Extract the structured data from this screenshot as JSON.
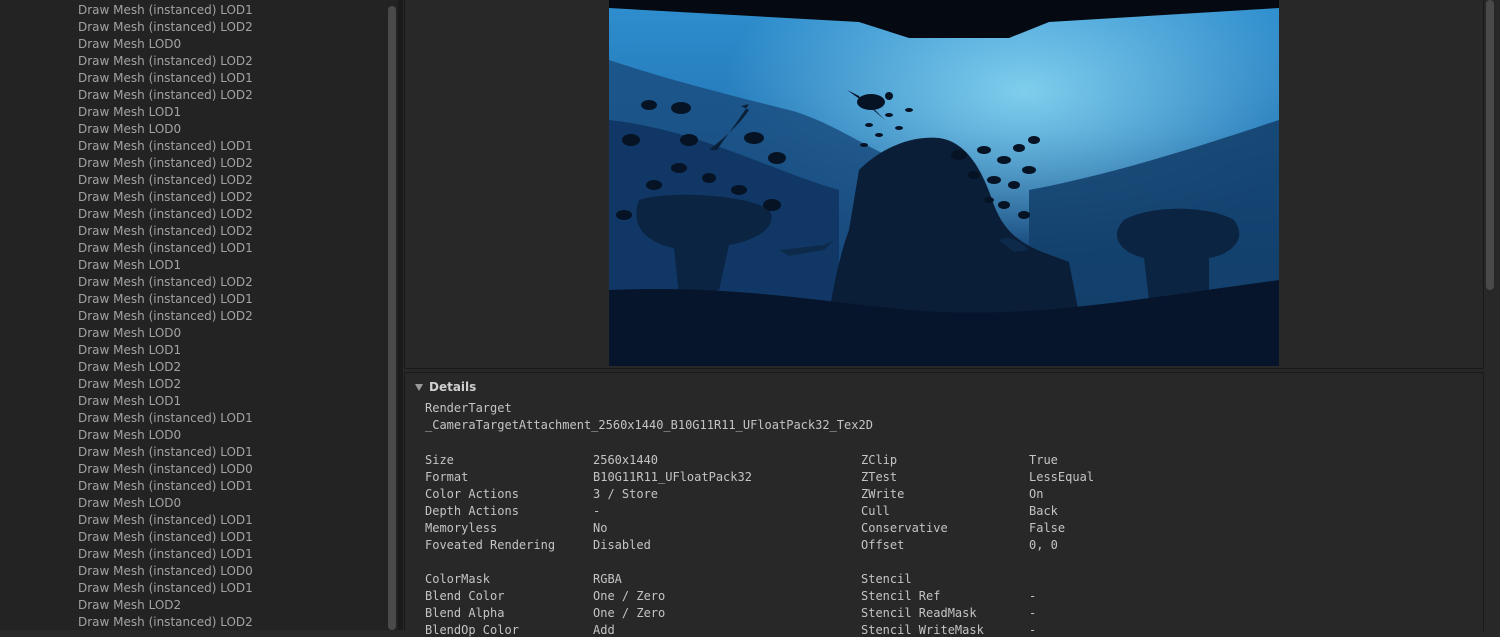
{
  "event_list": [
    "Draw Mesh (instanced) LOD1",
    "Draw Mesh (instanced) LOD2",
    "Draw Mesh LOD0",
    "Draw Mesh (instanced) LOD2",
    "Draw Mesh (instanced) LOD1",
    "Draw Mesh (instanced) LOD2",
    "Draw Mesh LOD1",
    "Draw Mesh LOD0",
    "Draw Mesh (instanced) LOD1",
    "Draw Mesh (instanced) LOD2",
    "Draw Mesh (instanced) LOD2",
    "Draw Mesh (instanced) LOD2",
    "Draw Mesh (instanced) LOD2",
    "Draw Mesh (instanced) LOD2",
    "Draw Mesh (instanced) LOD1",
    "Draw Mesh LOD1",
    "Draw Mesh (instanced) LOD2",
    "Draw Mesh (instanced) LOD1",
    "Draw Mesh (instanced) LOD2",
    "Draw Mesh LOD0",
    "Draw Mesh LOD1",
    "Draw Mesh LOD2",
    "Draw Mesh LOD2",
    "Draw Mesh LOD1",
    "Draw Mesh (instanced) LOD1",
    "Draw Mesh LOD0",
    "Draw Mesh (instanced) LOD1",
    "Draw Mesh (instanced) LOD0",
    "Draw Mesh (instanced) LOD1",
    "Draw Mesh LOD0",
    "Draw Mesh (instanced) LOD1",
    "Draw Mesh (instanced) LOD1",
    "Draw Mesh (instanced) LOD1",
    "Draw Mesh (instanced) LOD0",
    "Draw Mesh (instanced) LOD1",
    "Draw Mesh LOD2",
    "Draw Mesh (instanced) LOD2"
  ],
  "details": {
    "header": "Details",
    "render_target_label": "RenderTarget",
    "render_target_name": "_CameraTargetAttachment_2560x1440_B10G11R11_UFloatPack32_Tex2D",
    "left_props": [
      {
        "label": "Size",
        "value": "2560x1440"
      },
      {
        "label": "Format",
        "value": "B10G11R11_UFloatPack32"
      },
      {
        "label": "Color Actions",
        "value": "3 / Store"
      },
      {
        "label": "Depth Actions",
        "value": "-"
      },
      {
        "label": "Memoryless",
        "value": "No"
      },
      {
        "label": "Foveated Rendering",
        "value": "Disabled"
      },
      null,
      {
        "label": "ColorMask",
        "value": "RGBA"
      },
      {
        "label": "Blend Color",
        "value": "One / Zero"
      },
      {
        "label": "Blend Alpha",
        "value": "One / Zero"
      },
      {
        "label": "BlendOp Color",
        "value": "Add"
      }
    ],
    "right_props": [
      {
        "label": "ZClip",
        "value": "True"
      },
      {
        "label": "ZTest",
        "value": "LessEqual"
      },
      {
        "label": "ZWrite",
        "value": "On"
      },
      {
        "label": "Cull",
        "value": "Back"
      },
      {
        "label": "Conservative",
        "value": "False"
      },
      {
        "label": "Offset",
        "value": "0, 0"
      },
      null,
      {
        "label": "Stencil",
        "value": ""
      },
      {
        "label": "Stencil Ref",
        "value": "-"
      },
      {
        "label": "Stencil ReadMask",
        "value": "-"
      },
      {
        "label": "Stencil WriteMask",
        "value": "-"
      }
    ]
  }
}
